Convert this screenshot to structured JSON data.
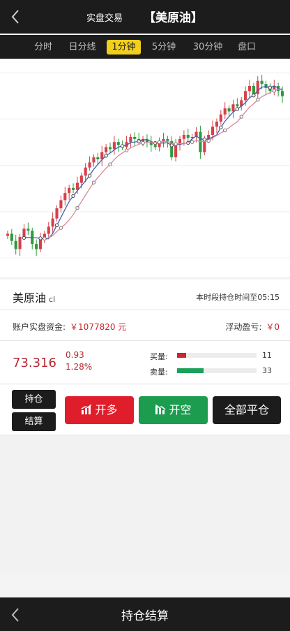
{
  "header": {
    "back_icon": "chevron-left-icon",
    "subtitle": "实盘交易",
    "title": "【美原油】"
  },
  "tabs": [
    {
      "label": "分时",
      "active": false
    },
    {
      "label": "日分线",
      "active": false
    },
    {
      "label": "1分钟",
      "active": true
    },
    {
      "label": "5分钟",
      "active": false
    },
    {
      "label": "30分钟",
      "active": false
    },
    {
      "label": "盘口",
      "active": false
    }
  ],
  "product": {
    "name": "美原油",
    "code": "cl",
    "hold_notice": "本时段持仓时间至05:15"
  },
  "fund": {
    "label": "账户实盘资金:",
    "value": "￥1077820 元",
    "pl_label": "浮动盈亏:",
    "pl_value": "￥0"
  },
  "quote": {
    "price": "73.316",
    "change": "0.93",
    "change_pct": "1.28%",
    "buy_label": "买量:",
    "buy_count": "11",
    "buy_ratio": 0.11,
    "sell_label": "卖量:",
    "sell_count": "33",
    "sell_ratio": 0.33,
    "buy_color": "#c9262e",
    "sell_color": "#1ba05a"
  },
  "actions": {
    "position_label": "持仓",
    "settle_label": "结算",
    "open_long_label": "开多",
    "open_short_label": "开空",
    "close_all_label": "全部平仓",
    "long_color": "#e01d2a",
    "short_color": "#1c9c4f",
    "close_color": "#1c1c1c"
  },
  "footer": {
    "back_icon": "chevron-left-icon",
    "title": "持仓结算"
  },
  "chart_data": {
    "type": "candlestick",
    "up_color": "#d6404b",
    "down_color": "#2c9b3c",
    "values": [
      72.05,
      71.98,
      71.9,
      72.02,
      72.1,
      72.08,
      71.95,
      71.9,
      72.0,
      72.05,
      72.12,
      72.2,
      72.3,
      72.38,
      72.45,
      72.5,
      72.48,
      72.55,
      72.62,
      72.7,
      72.75,
      72.8,
      72.78,
      72.85,
      72.9,
      72.88,
      72.95,
      72.92,
      72.9,
      72.95,
      73.0,
      72.98,
      72.95,
      72.98,
      72.95,
      72.92,
      72.9,
      72.95,
      72.98,
      72.96,
      72.8,
      72.92,
      72.98,
      73.02,
      72.99,
      73.0,
      73.05,
      72.85,
      72.98,
      73.02,
      73.1,
      73.15,
      73.22,
      73.28,
      73.25,
      73.32,
      73.3,
      73.36,
      73.45,
      73.5,
      73.42,
      73.55,
      73.52,
      73.48,
      73.45,
      73.5,
      73.45,
      73.4
    ]
  }
}
